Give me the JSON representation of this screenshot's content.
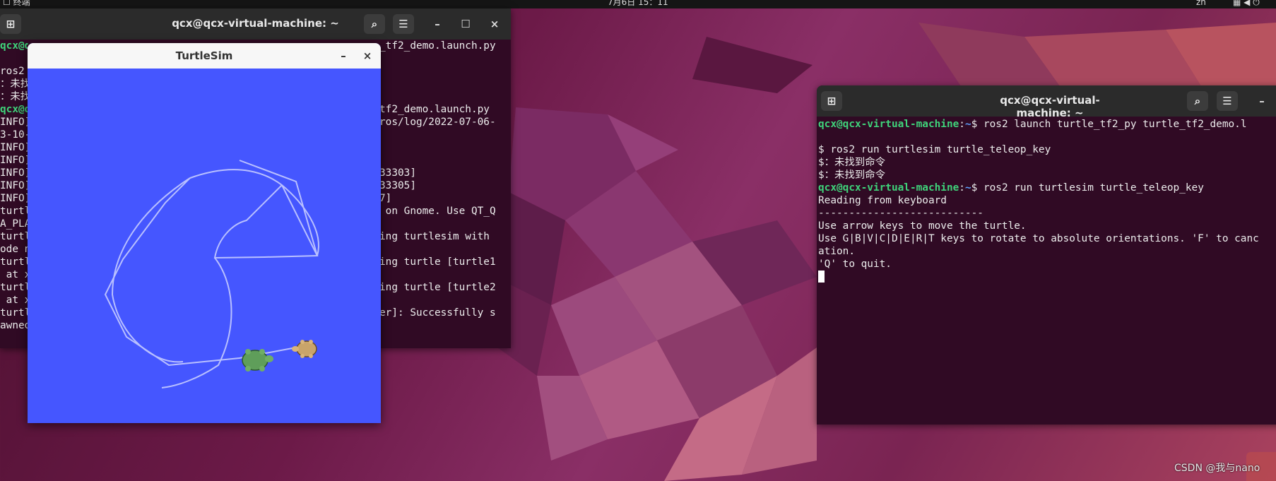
{
  "topbar": {
    "activity_label": "☐ 终端",
    "clock": "7月6日 15：11",
    "ime": "zh",
    "tray_icons": [
      "network-icon",
      "volume-icon",
      "power-icon"
    ]
  },
  "left_terminal": {
    "title": "qcx@qcx-virtual-machine: ~",
    "left_fragments": [
      "qcx@qcx",
      "",
      "ros2",
      "：未找",
      "：未找",
      "qcx@qc",
      "INFO]",
      "3-10-",
      "INFO]",
      "INFO]",
      "INFO]",
      "INFO]",
      "INFO]",
      "turtl",
      "A_PLA",
      "turtl",
      "ode n",
      "turtl",
      " at x",
      "turtl",
      " at x",
      "turtl",
      "awned"
    ],
    "right_fragments": [
      "_tf2_demo.launch.py",
      "",
      "",
      "",
      "",
      "tf2_demo.launch.py",
      "ros/log/2022-07-06-",
      "",
      "",
      "",
      "33303]",
      "33305]",
      "7]",
      " on Gnome. Use QT_Q",
      "",
      "ing turtlesim with",
      "",
      "ing turtle [turtle1",
      "",
      "ing turtle [turtle2",
      "",
      "er]: Successfully s",
      ""
    ]
  },
  "turtlesim": {
    "title": "TurtleSim",
    "minimize": "–",
    "close": "×",
    "background": "#4556ff",
    "trail_color": "#b9c0ff"
  },
  "right_terminal": {
    "title": "qcx@qcx-virtual-machine: ~",
    "lines": [
      {
        "type": "prompt",
        "user": "qcx@qcx-virtual-machine",
        "path": "~",
        "cmd": "$ ros2 launch turtle_tf2_py turtle_tf2_demo.l"
      },
      {
        "type": "text",
        "text": ""
      },
      {
        "type": "text",
        "text": "$ ros2 run turtlesim turtle_teleop_key"
      },
      {
        "type": "text",
        "text": "$：未找到命令"
      },
      {
        "type": "text",
        "text": "$：未找到命令"
      },
      {
        "type": "prompt",
        "user": "qcx@qcx-virtual-machine",
        "path": "~",
        "cmd": "$ ros2 run turtlesim turtle_teleop_key"
      },
      {
        "type": "text",
        "text": "Reading from keyboard"
      },
      {
        "type": "text",
        "text": "---------------------------"
      },
      {
        "type": "text",
        "text": "Use arrow keys to move the turtle."
      },
      {
        "type": "text",
        "text": "Use G|B|V|C|D|E|R|T keys to rotate to absolute orientations. 'F' to canc"
      },
      {
        "type": "text",
        "text": "ation."
      },
      {
        "type": "text",
        "text": "'Q' to quit."
      }
    ]
  },
  "watermark": "CSDN @我与nano"
}
